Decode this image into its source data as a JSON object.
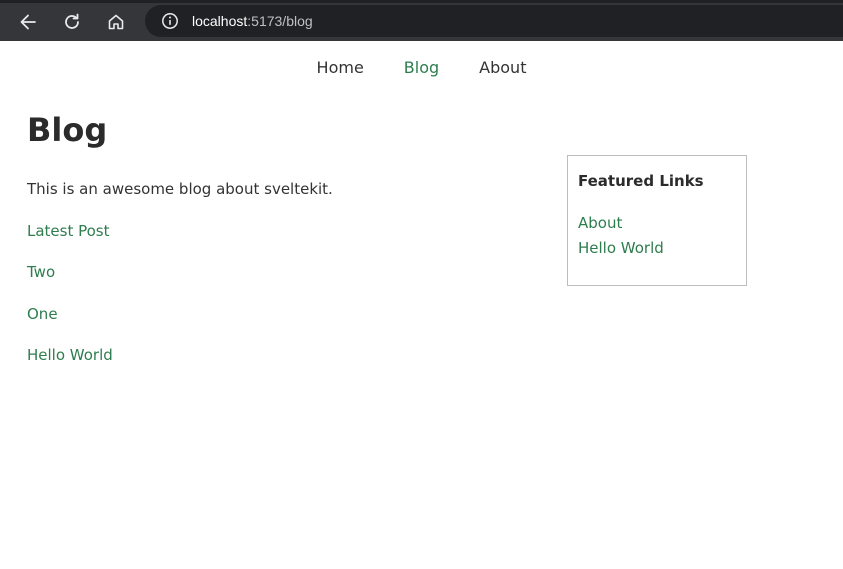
{
  "browser": {
    "url_host": "localhost",
    "url_rest": ":5173/blog",
    "icons": [
      "back-icon",
      "reload-icon",
      "home-icon",
      "info-icon"
    ]
  },
  "nav": {
    "items": [
      {
        "label": "Home",
        "active": false
      },
      {
        "label": "Blog",
        "active": true
      },
      {
        "label": "About",
        "active": false
      }
    ]
  },
  "main": {
    "title": "Blog",
    "intro": "This is an awesome blog about sveltekit.",
    "posts": [
      "Latest Post",
      "Two",
      "One",
      "Hello World"
    ]
  },
  "featured": {
    "heading": "Featured Links",
    "links": [
      "About",
      "Hello World"
    ]
  },
  "colors": {
    "link": "#2e7d4f",
    "toolbar": "#35363a",
    "addressbar": "#202124"
  }
}
